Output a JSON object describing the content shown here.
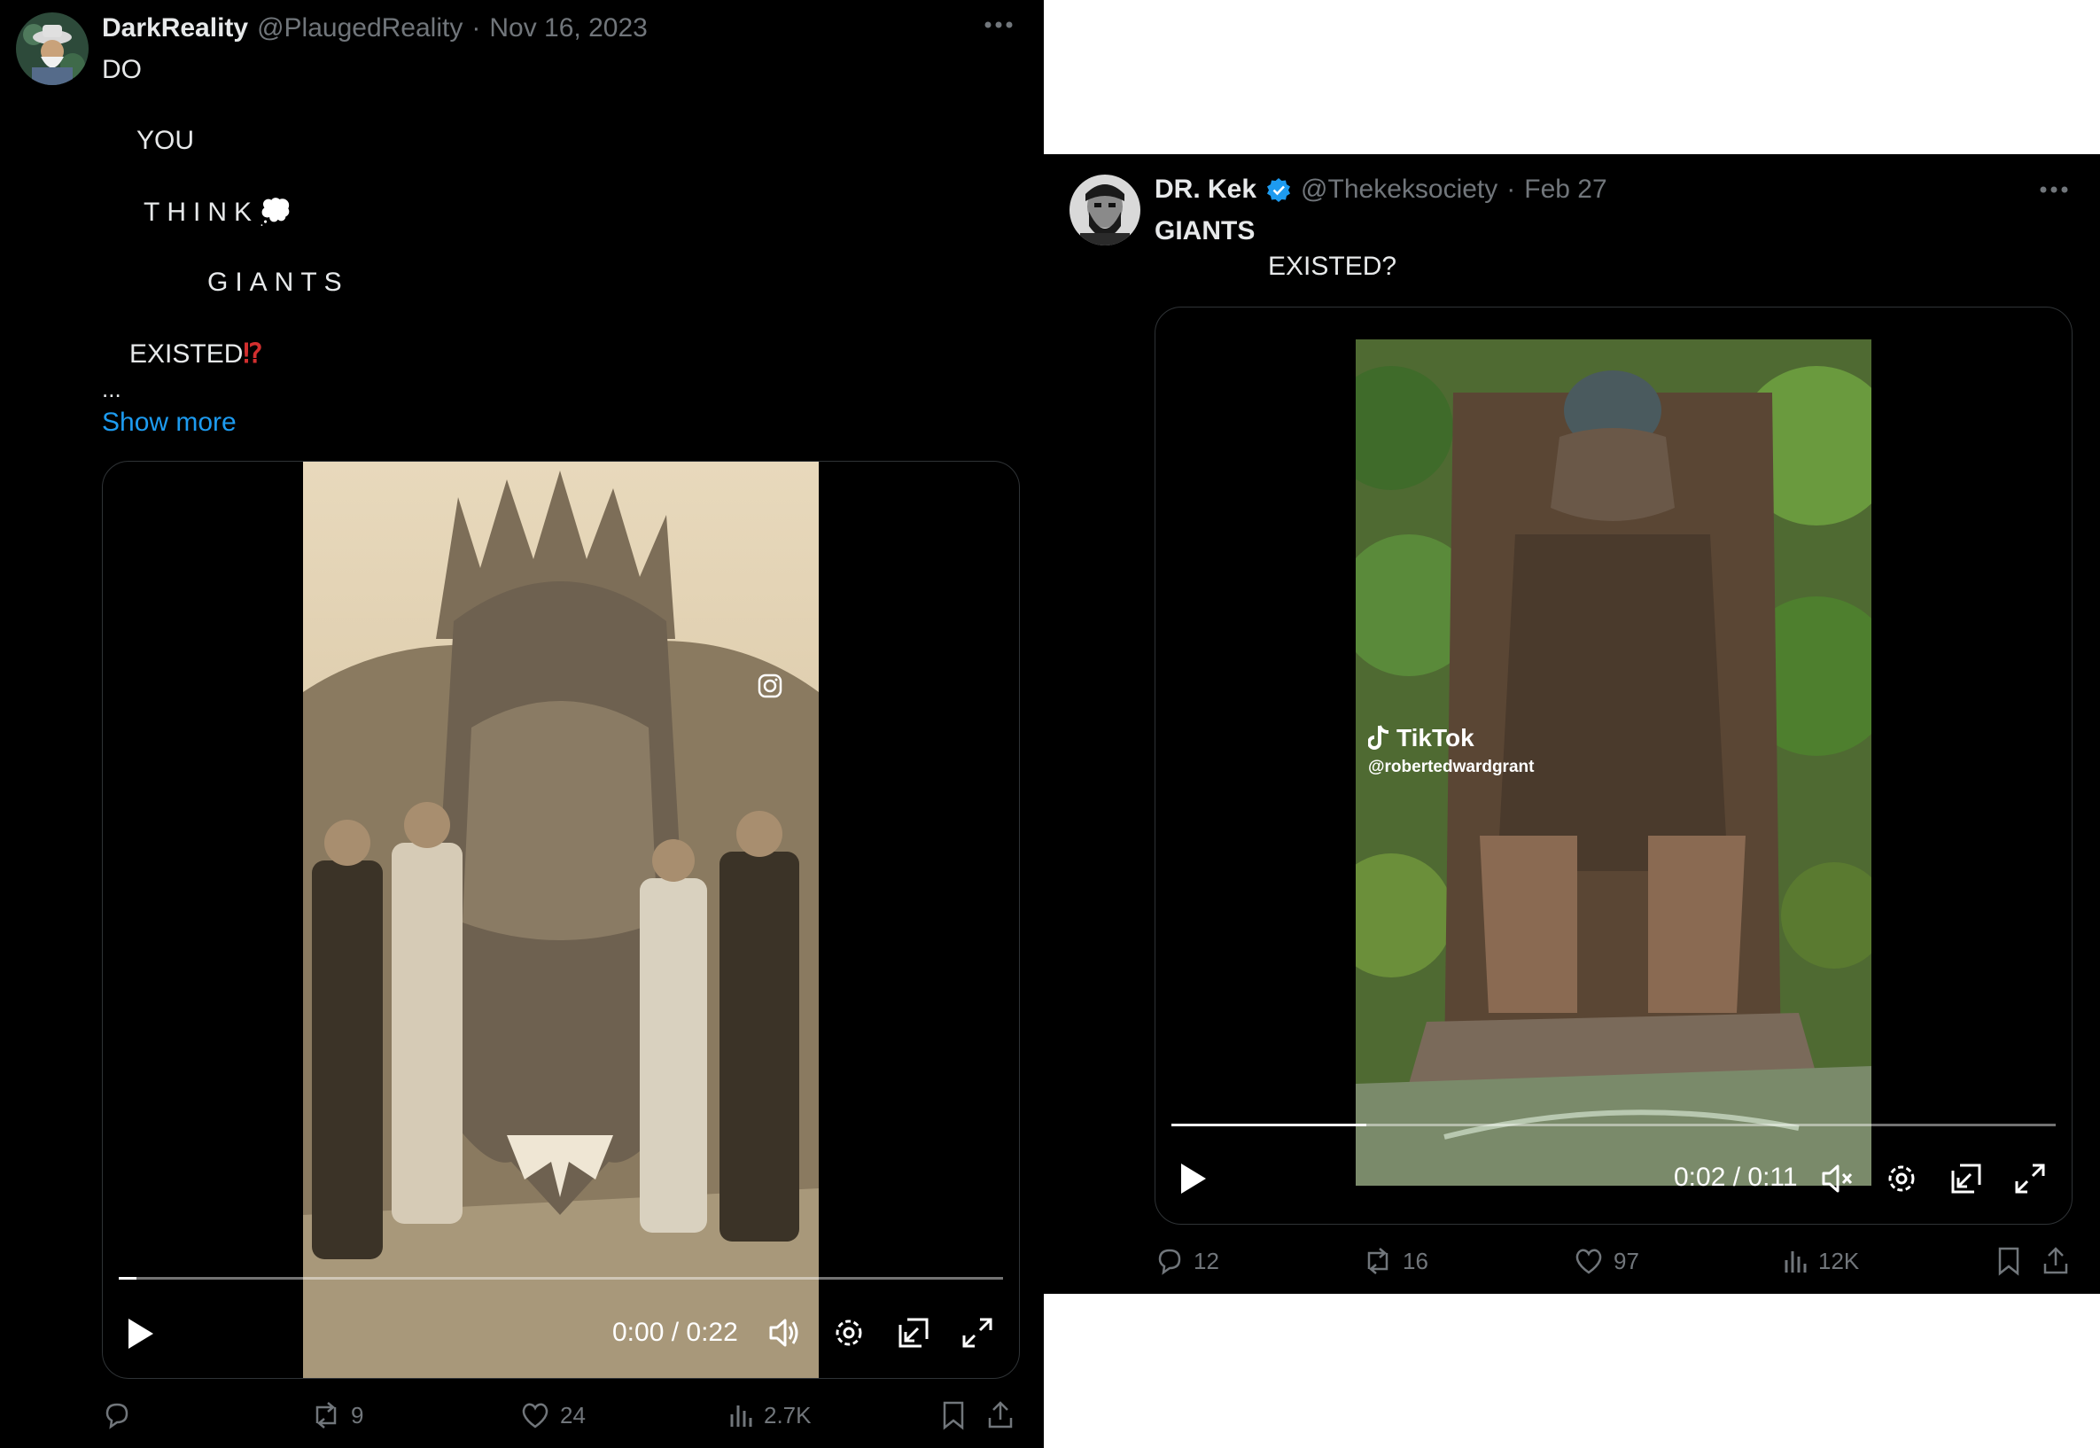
{
  "tweet1": {
    "display_name": "DarkReality",
    "handle": "@PlaugedReality",
    "separator": "·",
    "date": "Nov 16, 2023",
    "lines": [
      "DO",
      "YOU",
      "THINK",
      "GIANTS",
      "EXISTED"
    ],
    "think_emoji": "💭",
    "existed_emoji": "⁉",
    "ellipsis": "...",
    "show_more": "Show more",
    "video": {
      "time": "0:00 / 0:22",
      "progress": 0.02,
      "audio": "on"
    },
    "stats": {
      "replies": "",
      "reposts": "9",
      "likes": "24",
      "views": "2.7K"
    }
  },
  "tweet2": {
    "display_name": "DR. Kek",
    "handle": "@Thekeksociety",
    "separator": "·",
    "date": "Feb 27",
    "verified": true,
    "lines": [
      "GIANTS",
      "EXISTED?"
    ],
    "video": {
      "time": "0:02 / 0:11",
      "progress": 0.22,
      "audio": "muted",
      "watermark_brand": "TikTok",
      "watermark_user": "@robertedwardgrant"
    },
    "stats": {
      "replies": "12",
      "reposts": "16",
      "likes": "97",
      "views": "12K"
    }
  },
  "colors": {
    "background": "#000000",
    "text": "#e7e9ea",
    "muted": "#71767b",
    "link": "#1d9bf0",
    "verified": "#1d9bf0",
    "emoji_red": "#d32f2f"
  }
}
